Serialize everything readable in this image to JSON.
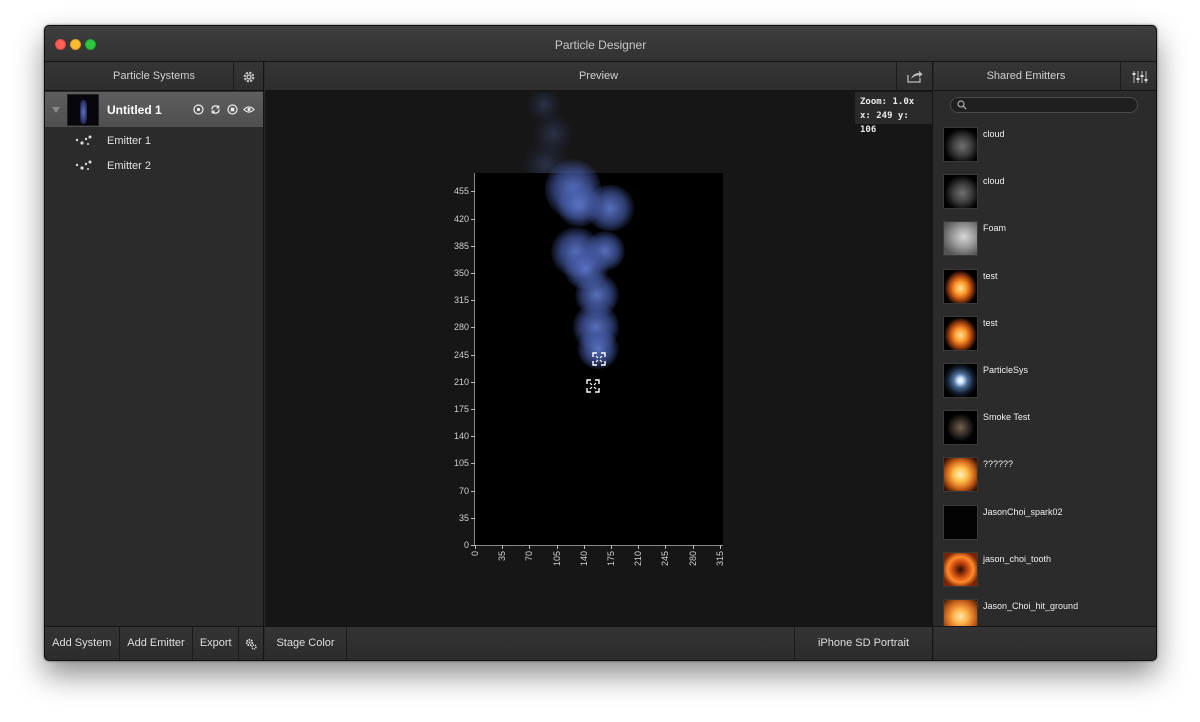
{
  "window": {
    "title": "Particle Designer"
  },
  "left_panel": {
    "header": "Particle Systems",
    "system": {
      "name": "Untitled 1"
    },
    "emitters": [
      "Emitter 1",
      "Emitter 2"
    ],
    "footer": {
      "add_system": "Add System",
      "add_emitter": "Add Emitter",
      "export": "Export"
    }
  },
  "center_panel": {
    "header": "Preview",
    "zoom_readout": "Zoom: 1.0x",
    "coord_readout": "x: 249 y: 106",
    "footer": {
      "stage_color": "Stage Color",
      "device": "iPhone SD Portrait"
    },
    "y_ticks": [
      "0",
      "35",
      "70",
      "105",
      "140",
      "175",
      "210",
      "245",
      "280",
      "315",
      "350",
      "385",
      "420",
      "455"
    ],
    "x_ticks": [
      "0",
      "35",
      "70",
      "105",
      "140",
      "175",
      "210",
      "245",
      "280",
      "315"
    ]
  },
  "right_panel": {
    "header": "Shared Emitters",
    "search": {
      "value": "",
      "placeholder": ""
    },
    "items": [
      {
        "name": "cloud",
        "thumb": "cloud"
      },
      {
        "name": "cloud",
        "thumb": "cloud"
      },
      {
        "name": "Foam",
        "thumb": "foam"
      },
      {
        "name": "test",
        "thumb": "flame"
      },
      {
        "name": "test",
        "thumb": "flame"
      },
      {
        "name": "ParticleSys",
        "thumb": "burst"
      },
      {
        "name": "Smoke Test",
        "thumb": "smoke"
      },
      {
        "name": "??????",
        "thumb": "fire"
      },
      {
        "name": "JasonChoi_spark02",
        "thumb": "dark"
      },
      {
        "name": "jason_choi_tooth",
        "thumb": "tooth"
      },
      {
        "name": "Jason_Choi_hit_ground",
        "thumb": "glow"
      }
    ]
  }
}
